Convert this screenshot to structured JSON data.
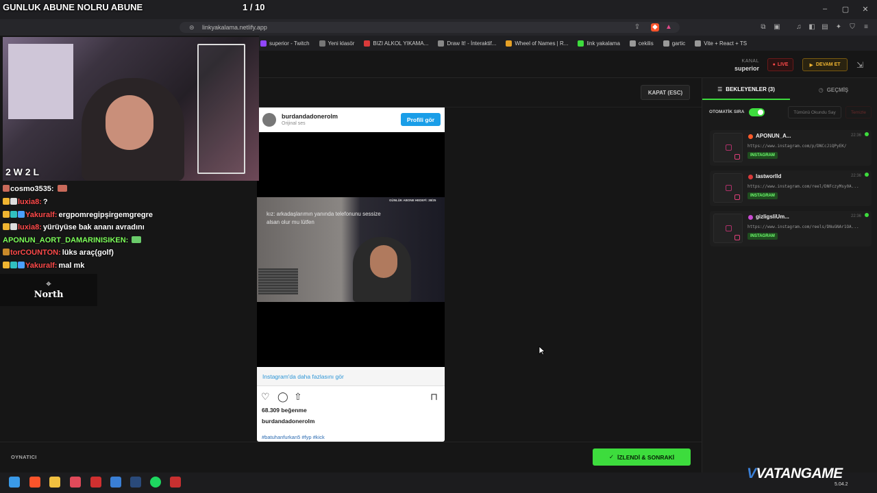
{
  "overlay": {
    "top_banner": "GUNLUK ABUNE NOLRU ABUNE",
    "counter": "1 / 10",
    "score": "2 W  2 L"
  },
  "browser": {
    "url": "linkyakalama.netlify.app",
    "bookmarks": [
      {
        "label": "superior - Twitch",
        "color": "#9146ff"
      },
      {
        "label": "Yeni klasör",
        "color": "#777777"
      },
      {
        "label": "BIZI ALKOL YIKAMA...",
        "color": "#d93a3a"
      },
      {
        "label": "Draw It! - İnteraktif...",
        "color": "#888888"
      },
      {
        "label": "Wheel of Names | R...",
        "color": "#e6a126"
      },
      {
        "label": "link yakalama",
        "color": "#3ddc3d"
      },
      {
        "label": "cekilis",
        "color": "#999999"
      },
      {
        "label": "gartic",
        "color": "#999999"
      },
      {
        "label": "Vite + React + TS",
        "color": "#999999"
      }
    ]
  },
  "chat": [
    {
      "user": "cosmo3535:",
      "msg": "",
      "user_color": "#ffffff",
      "badges": [
        "#c96a5a"
      ]
    },
    {
      "user": "luxia8:",
      "msg": "?",
      "user_color": "#ff4a4a",
      "badges": [
        "#f0b531",
        "#dddddd"
      ]
    },
    {
      "user": "Yakuralf:",
      "msg": "ergpomregipşirgemgregre",
      "user_color": "#ff4a4a",
      "badges": [
        "#f0b531",
        "#31c0c0",
        "#4aa0ff"
      ]
    },
    {
      "user": "luxia8:",
      "msg": "yürüyüse bak ananı avradını",
      "user_color": "#ff4a4a",
      "badges": [
        "#f0b531",
        "#dddddd"
      ]
    },
    {
      "user": "APONUN_AORT_DAMARINISIKEN:",
      "msg": "",
      "user_color": "#7dff5a",
      "badges": []
    },
    {
      "user": "torCOUNTON:",
      "msg": "lüks araç(golf)",
      "user_color": "#ff4a4a",
      "badges": [
        "#c98a2a"
      ]
    },
    {
      "user": "Yakuralf:",
      "msg": "mal mk",
      "user_color": "#ff4a4a",
      "badges": [
        "#f0b531",
        "#31c0c0",
        "#4aa0ff"
      ]
    }
  ],
  "north_logo": "North",
  "header": {
    "kanal_label": "KANAL",
    "kanal_value": "superior",
    "live_label": "LIVE",
    "devam_label": "DEVAM ET",
    "kapat_label": "KAPAT (ESC)"
  },
  "instagram": {
    "username": "burdandadonerolm",
    "subtitle": "Orijinal ses",
    "profile_button": "Profili gör",
    "video_goal": "GÜNLÜK ABONE HEDEFİ: 38/25",
    "video_caption": "kız: arkadaşlarımın yanında telefonunu sessize alsan olur mu lütfen",
    "more_link": "Instagram'da daha fazlasını gör",
    "likes": "68.309 beğenme",
    "owner": "burdandadonerolm",
    "tags": "#batuhanfurkan5 #fyp #kick"
  },
  "panel": {
    "tab_waiting": "BEKLEYENLER (3)",
    "tab_history": "GEÇMİŞ",
    "auto_label": "OTOMATİK SIRA",
    "auto_enabled": true,
    "mark_all_label": "Tümünü Okundu Say",
    "clear_label": "Temizle",
    "queue": [
      {
        "name": "APONUN_A...",
        "time": "22:36",
        "url": "https://www.instagram.com/p/DNCcJiQPyEK/",
        "tag": "INSTAGRAM",
        "avatar_color": "#ff5a2a"
      },
      {
        "name": "lastworlld",
        "time": "22:36",
        "url": "https://www.instagram.com/reel/DNFczyMsy0A...",
        "tag": "INSTAGRAM",
        "avatar_color": "#d93a3a"
      },
      {
        "name": "gizligsliUm...",
        "time": "22:36",
        "url": "https://www.instagram.com/reels/DNuGNAr1OA...",
        "tag": "INSTAGRAM",
        "avatar_color": "#c84ad0"
      }
    ]
  },
  "footer": {
    "player_label": "OYNATICI",
    "next_button": "İZLENDİ & SONRAKİ"
  },
  "watermark": {
    "brand": "VATANGAME",
    "version": "5.04.2"
  },
  "taskbar_icons": [
    {
      "name": "windows-start-icon",
      "color": "#3a9ae8"
    },
    {
      "name": "brave-browser-icon",
      "color": "#fb542b"
    },
    {
      "name": "file-explorer-icon",
      "color": "#f0c040"
    },
    {
      "name": "maps-icon",
      "color": "#e04a5a"
    },
    {
      "name": "app-red-icon",
      "color": "#d03030"
    },
    {
      "name": "app-blue-icon",
      "color": "#3a7fd6"
    },
    {
      "name": "steam-icon",
      "color": "#2a4a7a"
    },
    {
      "name": "spotify-icon",
      "color": "#1ed760"
    },
    {
      "name": "voicemod-icon",
      "color": "#c83030"
    }
  ]
}
